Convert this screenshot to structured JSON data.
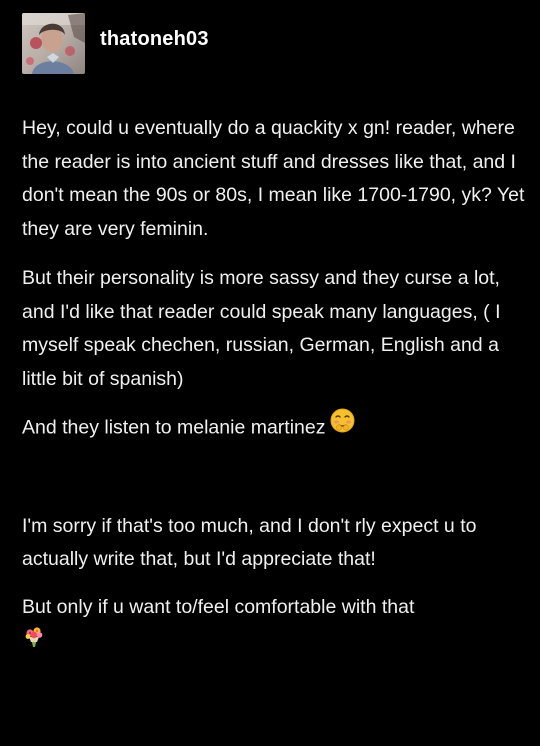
{
  "post": {
    "username": "thatoneh03",
    "paragraphs": [
      "Hey, could u eventually do a quackity x gn! reader, where the reader is into ancient stuff and dresses like that, and I don't mean the 90s or 80s, I mean like 1700-1790, yk? Yet they are very feminin.",
      "But their personality is more sassy and they curse a lot, and I'd like that reader could speak many languages, ( I myself speak chechen, russian, German, English and a little bit of spanish)",
      "And they listen to melanie martinez",
      "I'm sorry if that's too much, and I don't rly expect u to actually write that, but I'd appreciate that!",
      "But only if u want to/feel comfortable with that"
    ],
    "icons": {
      "avatar": "avatar-image",
      "shy_face": "shy-face-emoji-icon",
      "bouquet": "bouquet-emoji-icon"
    }
  }
}
